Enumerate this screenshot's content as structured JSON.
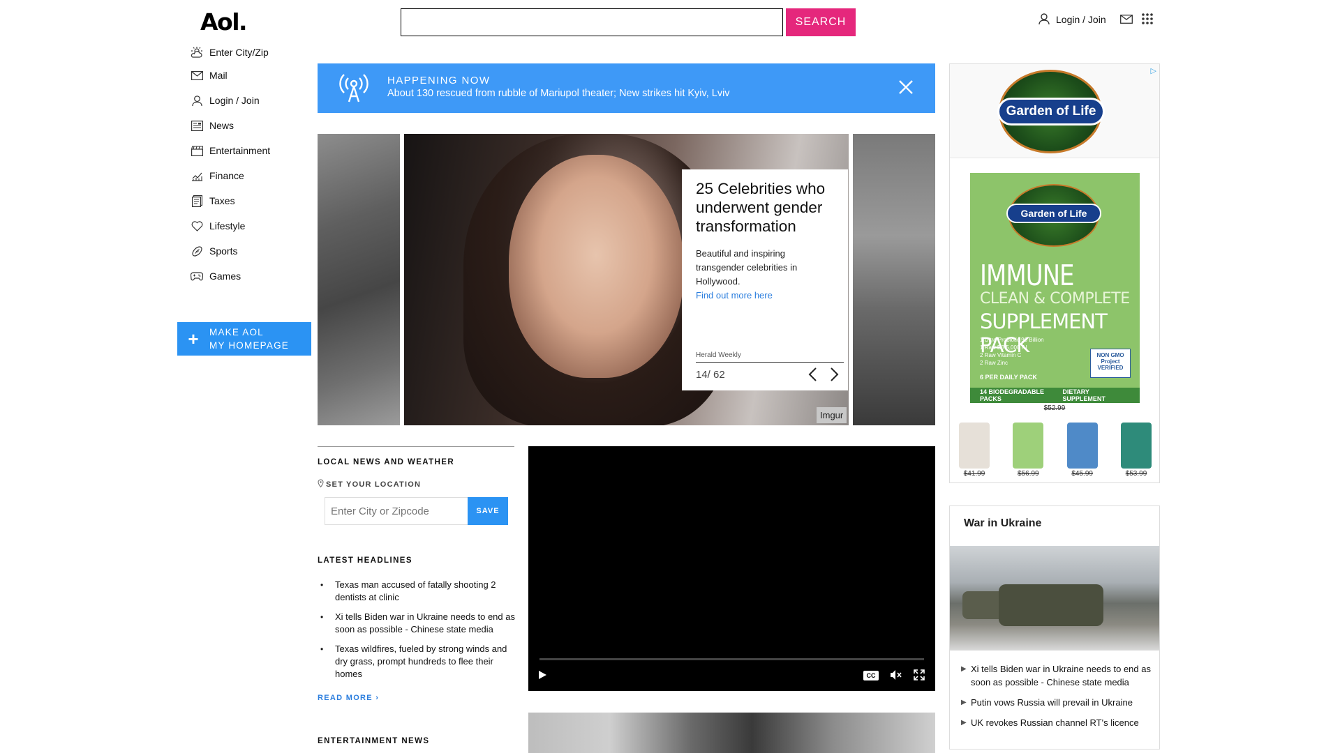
{
  "header": {
    "logo": "Aol.",
    "search_placeholder": "",
    "search_button": "SEARCH",
    "login_label": "Login / Join",
    "icons": [
      "user-icon",
      "mail-icon",
      "apps-grid-icon"
    ]
  },
  "sidebar": {
    "items": [
      {
        "label": "Enter City/Zip",
        "icon": "weather-icon"
      },
      {
        "label": "Mail",
        "icon": "mail-icon"
      },
      {
        "label": "Login / Join",
        "icon": "user-icon"
      },
      {
        "label": "News",
        "icon": "news-icon"
      },
      {
        "label": "Entertainment",
        "icon": "clapperboard-icon"
      },
      {
        "label": "Finance",
        "icon": "finance-chart-icon"
      },
      {
        "label": "Taxes",
        "icon": "taxes-icon"
      },
      {
        "label": "Lifestyle",
        "icon": "heart-icon"
      },
      {
        "label": "Sports",
        "icon": "football-icon"
      },
      {
        "label": "Games",
        "icon": "gamepad-icon"
      }
    ],
    "make_homepage_line1": "MAKE AOL",
    "make_homepage_line2": "MY HOMEPAGE"
  },
  "banner": {
    "title": "HAPPENING NOW",
    "text": "About 130 rescued from rubble of Mariupol theater; New strikes hit Kyiv, Lviv",
    "color": "#3e99f7"
  },
  "slideshow": {
    "title": "25 Celebrities who underwent gender transformation",
    "description": "Beautiful and inspiring transgender celebrities in Hollywood.",
    "link": "Find out more here",
    "source": "Herald Weekly",
    "counter": "14/ 62",
    "credit": "Imgur"
  },
  "local": {
    "title": "LOCAL NEWS AND WEATHER",
    "set_location": "SET YOUR LOCATION",
    "zip_placeholder": "Enter City or Zipcode",
    "save": "SAVE",
    "headlines_title": "LATEST HEADLINES",
    "headlines": [
      "Texas man accused of fatally shooting 2 dentists at clinic",
      "Xi tells Biden war in Ukraine needs to end as soon as possible - Chinese state media",
      "Texas wildfires, fueled by strong winds and dry grass, prompt hundreds to flee their homes"
    ],
    "read_more": "READ MORE ›",
    "entertainment_title": "ENTERTAINMENT NEWS"
  },
  "video": {
    "cc": "CC",
    "progress": 0
  },
  "ad": {
    "choice": "▷",
    "brand": "Garden of Life",
    "product_line1": "IMMUNE",
    "product_line2": "CLEAN & COMPLETE",
    "product_line3": "SUPPLEMENT PACK",
    "ingredients": [
      "1  Ultra Probiotic 90 Billion",
      "1  Raw D3 5,000 IU",
      "2  Raw Vitamin C",
      "2  Raw Zinc"
    ],
    "daily": "6 PER DAILY PACK",
    "foot_left": "14 BIODEGRADABLE PACKS",
    "foot_right": "DIETARY SUPPLEMENT",
    "non_gmo": "NON GMO Project VERIFIED",
    "main_price": "$52.99",
    "products": [
      {
        "price": "$41.99",
        "color": "#e6e0d8"
      },
      {
        "price": "$56.99",
        "color": "#9ed07a"
      },
      {
        "price": "$45.99",
        "color": "#4f8ac8"
      },
      {
        "price": "$53.99",
        "color": "#2e8b7a"
      }
    ]
  },
  "ukraine": {
    "title": "War in Ukraine",
    "items": [
      "Xi tells Biden war in Ukraine needs to end as soon as possible - Chinese state media",
      "Putin vows Russia will prevail in Ukraine",
      "UK revokes Russian channel RT's licence"
    ]
  }
}
